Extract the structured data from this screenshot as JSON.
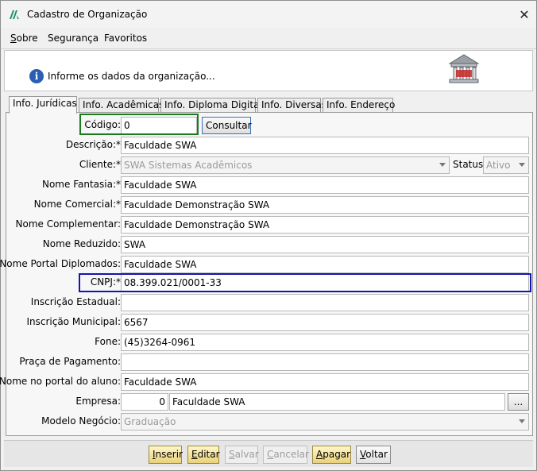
{
  "window": {
    "title": "Cadastro de Organização"
  },
  "menu": [
    "Sobre",
    "Segurança",
    "Favoritos"
  ],
  "header": {
    "info_text": "Informe os dados da organização..."
  },
  "tabs": [
    "Info. Jurídicas",
    "Info. Acadêmicas",
    "Info. Diploma Digital",
    "Info. Diversas",
    "Info. Endereço"
  ],
  "form": {
    "codigo": {
      "label": "Código:",
      "value": "0",
      "button": "Consultar"
    },
    "descricao": {
      "label": "Descrição:*",
      "value": "Faculdade SWA"
    },
    "cliente": {
      "label": "Cliente:*",
      "value": "SWA Sistemas Acadêmicos",
      "status_label": "Status:",
      "status_value": "Ativo"
    },
    "nome_fantasia": {
      "label": "Nome Fantasia:*",
      "value": "Faculdade SWA"
    },
    "nome_comercial": {
      "label": "Nome Comercial:*",
      "value": "Faculdade Demonstração SWA"
    },
    "nome_complementar": {
      "label": "Nome Complementar:",
      "value": "Faculdade Demonstração SWA"
    },
    "nome_reduzido": {
      "label": "Nome Reduzido:",
      "value": "SWA"
    },
    "nome_portal_diplomados": {
      "label": "Nome Portal Diplomados:",
      "value": "Faculdade SWA"
    },
    "cnpj": {
      "label": "CNPJ:*",
      "value": "08.399.021/0001-33"
    },
    "inscricao_estadual": {
      "label": "Inscrição Estadual:",
      "value": ""
    },
    "inscricao_municipal": {
      "label": "Inscrição Municipal:",
      "value": "6567"
    },
    "fone": {
      "label": "Fone:",
      "value": "(45)3264-0961"
    },
    "praca_pagamento": {
      "label": "Praça de Pagamento:",
      "value": ""
    },
    "nome_portal_aluno": {
      "label": "Nome no portal do aluno:",
      "value": "Faculdade SWA"
    },
    "empresa": {
      "label": "Empresa:",
      "code": "0",
      "value": "Faculdade SWA",
      "button": "..."
    },
    "modelo_negocio": {
      "label": "Modelo Negócio:",
      "value": "Graduação"
    }
  },
  "footer": {
    "inserir": {
      "first": "I",
      "rest": "nserir"
    },
    "editar": {
      "first": "E",
      "rest": "ditar"
    },
    "salvar": {
      "first": "S",
      "rest": "alvar"
    },
    "cancelar": {
      "first": "C",
      "rest": "ancelar"
    },
    "apagar": {
      "first": "A",
      "rest": "pagar"
    },
    "voltar": {
      "first": "V",
      "rest": "oltar"
    }
  },
  "icons": [
    "app-logo-icon",
    "close-icon",
    "info-icon",
    "bank-building-icon",
    "chevron-down-icon"
  ],
  "colors": {
    "highlight_green": "#1d7a1d",
    "highlight_blue": "#1414b4",
    "info_blue": "#2b5fb3",
    "active_button": "#ead27a"
  }
}
